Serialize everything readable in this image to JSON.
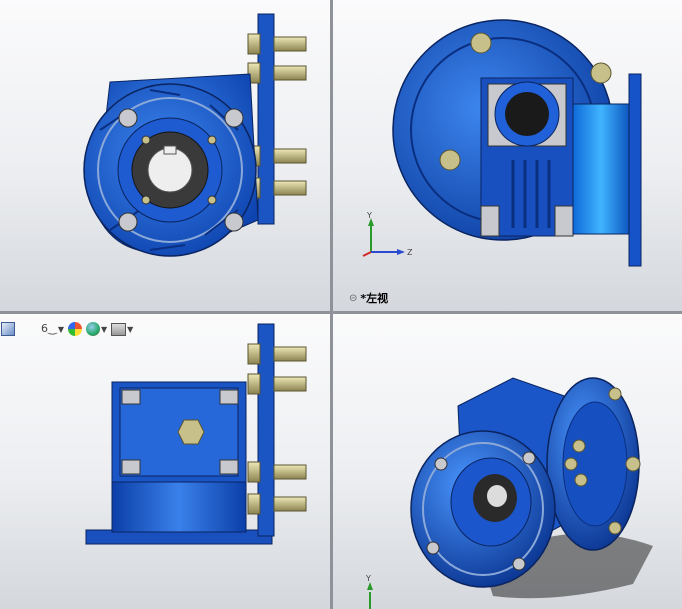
{
  "viewports": {
    "top_left": {},
    "top_right": {
      "view_label": "*左视"
    },
    "bottom_left": {},
    "bottom_right": {}
  },
  "triad": {
    "x": "Z",
    "y": "Y"
  },
  "toolbar": {
    "items": [
      {
        "icon": "view-orientation-icon",
        "has_dropdown": false
      },
      {
        "icon": "display-style-icon",
        "has_dropdown": true
      },
      {
        "icon": "appearance-icon",
        "has_dropdown": false
      },
      {
        "icon": "scene-icon",
        "has_dropdown": true
      },
      {
        "icon": "view-settings-icon",
        "has_dropdown": true
      }
    ]
  },
  "colors": {
    "part_blue": "#1f5fd0",
    "part_dark": "#0d2f7a",
    "bolt_brass": "#c8c08a",
    "background": "#f3f4f6",
    "divider": "#8f9298"
  }
}
